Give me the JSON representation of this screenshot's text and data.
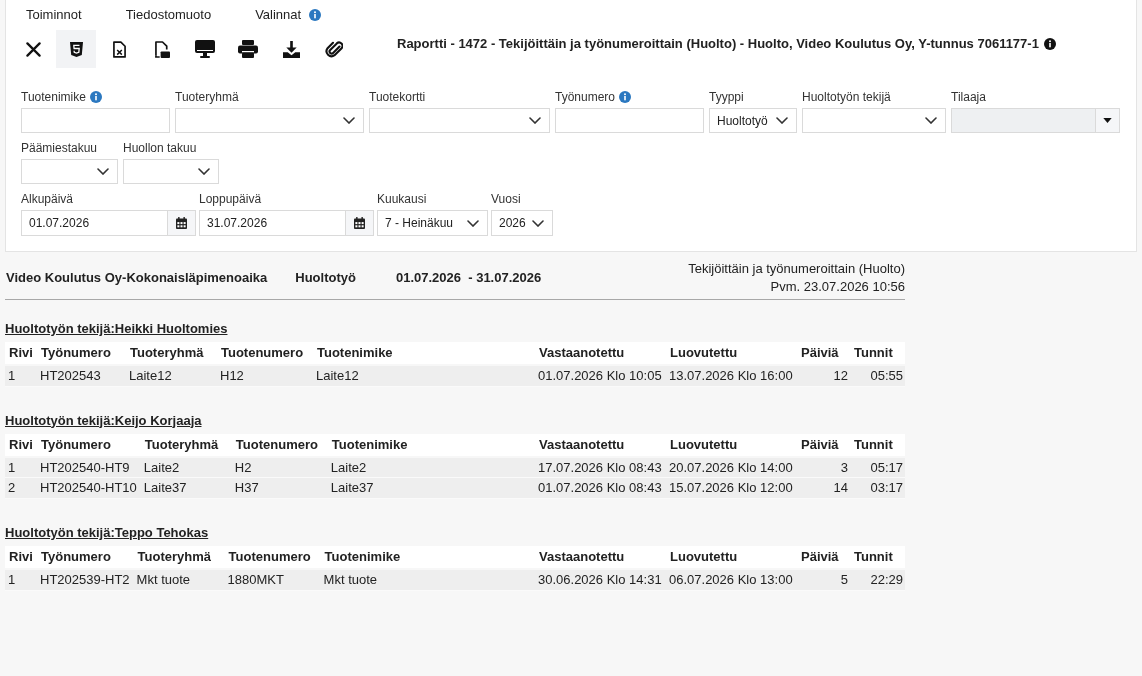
{
  "menu": [
    {
      "label": "Toiminnot",
      "info": false
    },
    {
      "label": "Tiedostomuoto",
      "info": false
    },
    {
      "label": "Valinnat",
      "info": true
    }
  ],
  "toolbar": [
    {
      "kind": "close",
      "selected": false
    },
    {
      "kind": "html",
      "selected": true
    },
    {
      "kind": "excel",
      "selected": false
    },
    {
      "kind": "pdf",
      "selected": false
    },
    {
      "kind": "screen",
      "selected": false
    },
    {
      "kind": "print",
      "selected": false
    },
    {
      "kind": "download",
      "selected": false
    },
    {
      "kind": "attach",
      "selected": false
    }
  ],
  "report_title": {
    "text": "Raportti - 1472 - Tekijöittäin ja työnumeroittain (Huolto) - Huolto, Video Koulutus Oy, Y-tunnus 7061177-1",
    "info": true
  },
  "filters": [
    {
      "fields": [
        {
          "label": "Tuotenimike",
          "info": true,
          "kind": "text",
          "disabled": false
        },
        {
          "label": "Tuoteryhmä",
          "info": false,
          "kind": "select",
          "disabled": false
        },
        {
          "label": "Tuotekortti",
          "info": false,
          "kind": "select",
          "disabled": false
        },
        {
          "label": "Työnumero",
          "info": true,
          "kind": "text",
          "disabled": false
        },
        {
          "label": "Tyyppi",
          "info": false,
          "kind": "select",
          "value": "Huoltotyö",
          "disabled": false
        },
        {
          "label": "Huoltotyön tekijä",
          "info": false,
          "kind": "select",
          "disabled": false
        },
        {
          "label": "Tilaaja",
          "info": false,
          "kind": "combo",
          "disabled": true
        }
      ]
    },
    {
      "fields": [
        {
          "label": "Päämiestakuu",
          "info": false,
          "kind": "select",
          "disabled": false
        },
        {
          "label": "Huollon takuu",
          "info": false,
          "kind": "select",
          "disabled": false
        }
      ]
    },
    {
      "fields": [
        {
          "label": "Alkupäivä",
          "info": false,
          "kind": "date",
          "value": "01.07.2026",
          "disabled": false
        },
        {
          "label": "Loppupäivä",
          "info": false,
          "kind": "date",
          "value": "31.07.2026",
          "disabled": false
        },
        {
          "label": "Kuukausi",
          "info": false,
          "kind": "select",
          "value": "7 - Heinäkuu",
          "disabled": false
        },
        {
          "label": "Vuosi",
          "info": false,
          "kind": "select",
          "value": "2026",
          "disabled": false
        }
      ]
    }
  ],
  "report": {
    "heading": {
      "company": "Video Koulutus Oy-Kokonaisläpimenoaika",
      "work_type": "Huoltotyö",
      "period": "01.07.2026  - 31.07.2026",
      "report_name": "Tekijöittäin ja työnumeroittain (Huolto)",
      "printed": "Pvm. 23.07.2026 10:56"
    },
    "groups": [
      {
        "heading": "Huoltotyön tekijä:Heikki Huoltomies",
        "columns": [
          "Rivi",
          "Työnumero",
          "Tuoteryhmä",
          "Tuotenumero",
          "Tuotenimike",
          "Vastaanotettu",
          "Luovutettu",
          "Päiviä",
          "Tunnit"
        ],
        "rows": [
          [
            "1",
            "HT202543",
            "Laite12",
            "H12",
            "Laite12",
            "01.07.2026 Klo 10:05",
            "13.07.2026 Klo 16:00",
            "12",
            "05:55"
          ]
        ]
      },
      {
        "heading": "Huoltotyön tekijä:Keijo Korjaaja",
        "columns": [
          "Rivi",
          "Työnumero",
          "Tuoteryhmä",
          "Tuotenumero",
          "Tuotenimike",
          "Vastaanotettu",
          "Luovutettu",
          "Päiviä",
          "Tunnit"
        ],
        "rows": [
          [
            "1",
            "HT202540-HT9",
            "Laite2",
            "H2",
            "Laite2",
            "17.07.2026 Klo 08:43",
            "20.07.2026 Klo 14:00",
            "3",
            "05:17"
          ],
          [
            "2",
            "HT202540-HT10",
            "Laite37",
            "H37",
            "Laite37",
            "01.07.2026 Klo 08:43",
            "15.07.2026 Klo 12:00",
            "14",
            "03:17"
          ]
        ]
      },
      {
        "heading": "Huoltotyön tekijä:Teppo Tehokas",
        "columns": [
          "Rivi",
          "Työnumero",
          "Tuoteryhmä",
          "Tuotenumero",
          "Tuotenimike",
          "Vastaanotettu",
          "Luovutettu",
          "Päiviä",
          "Tunnit"
        ],
        "rows": [
          [
            "1",
            "HT202539-HT2",
            "Mkt tuote",
            "1880MKT",
            "Mkt tuote",
            "30.06.2026 Klo 14:31",
            "06.07.2026 Klo 13:00",
            "5",
            "22:29"
          ]
        ]
      }
    ]
  }
}
